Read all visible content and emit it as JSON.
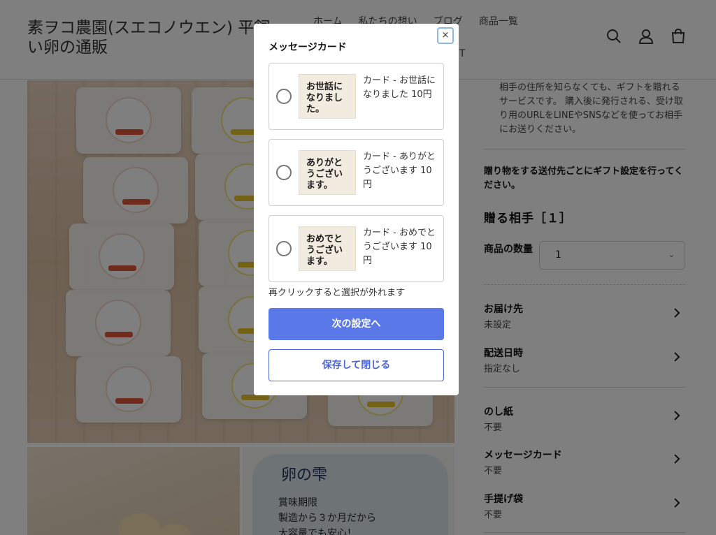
{
  "header": {
    "logo": "素ヲコ農園(スエコノウエン) 平飼い卵の通販",
    "nav": [
      "ホーム",
      "私たちの想い",
      "ブログ",
      "商品一覧",
      "ET"
    ]
  },
  "icons": {
    "search": "search-icon",
    "account": "user-icon",
    "cart": "cart-icon"
  },
  "gallery": {
    "sub2_title": "卵の雫",
    "sub2_lines": [
      "賞味期限",
      "製造から３か月だから",
      "大容量でも安心！"
    ]
  },
  "right_panel": {
    "intro": "相手の住所を知らなくても、ギフトを贈れるサービスです。 購入後に発行される、受け取り用のURLをLINEやSNSなどを使ってお相手にお送りください。",
    "instruction": "贈り物をする送付先ごとにギフト設定を行ってください。",
    "recipient_heading": "贈る相手［１］",
    "quantity_label": "商品の数量",
    "quantity_value": "1",
    "rows": [
      {
        "title": "お届け先",
        "value": "未設定"
      },
      {
        "title": "配送日時",
        "value": "指定なし"
      },
      {
        "title": "のし紙",
        "value": "不要"
      },
      {
        "title": "メッセージカード",
        "value": "不要"
      },
      {
        "title": "手提げ袋",
        "value": "不要"
      }
    ]
  },
  "modal": {
    "title": "メッセージカード",
    "close": "×",
    "options": [
      {
        "label": "カード - お世話になりました 10円",
        "thumb": "お世話になりました。"
      },
      {
        "label": "カード - ありがとうございます 10円",
        "thumb": "ありがとうございます。"
      },
      {
        "label": "カード - おめでとうございます 10円",
        "thumb": "おめでとうございます。"
      }
    ],
    "hint": "再クリックすると選択が外れます",
    "next_button": "次の設定へ",
    "save_button": "保存して閉じる"
  },
  "colors": {
    "primary": "#5a78e8",
    "overlay": "rgba(0,0,0,0.5)"
  }
}
